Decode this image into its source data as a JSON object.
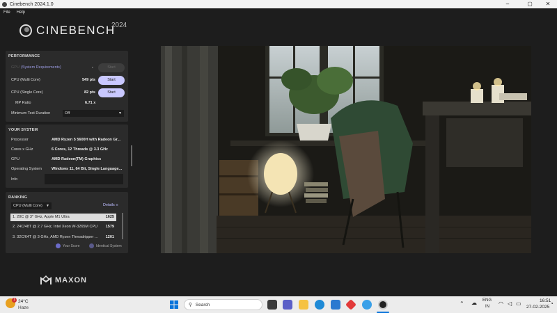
{
  "window": {
    "title": "Cinebench 2024.1.0",
    "controls": {
      "minimize": "–",
      "maximize": "▢",
      "close": "✕"
    }
  },
  "menu": [
    "File",
    "Help"
  ],
  "brand": {
    "name": "CINEBENCH",
    "year": "2024"
  },
  "performance": {
    "heading": "PERFORMANCE",
    "gpu": {
      "label": "GPU",
      "link": "(System Requirements)",
      "value": "-",
      "button": "Start"
    },
    "cpu_multi": {
      "label": "CPU (Multi Core)",
      "value": "549 pts",
      "button": "Start"
    },
    "cpu_single": {
      "label": "CPU (Single Core)",
      "value": "82 pts",
      "button": "Start"
    },
    "mp_ratio": {
      "label": "MP Ratio",
      "value": "6.71 x"
    },
    "min_test": {
      "label": "Minimum Test Duration",
      "value": "Off"
    }
  },
  "system": {
    "heading": "YOUR SYSTEM",
    "rows": [
      {
        "label": "Processor",
        "value": "AMD Ryzen 5 5600H with Radeon Gr..."
      },
      {
        "label": "Cores x GHz",
        "value": "6 Cores, 12 Threads @ 3.3 GHz"
      },
      {
        "label": "GPU",
        "value": "AMD Radeon(TM) Graphics"
      },
      {
        "label": "Operating System",
        "value": "Windows 11, 64 Bit, Single Language..."
      },
      {
        "label": "Info",
        "value": ""
      }
    ]
  },
  "ranking": {
    "heading": "RANKING",
    "filter": "CPU (Multi Core)",
    "details": "Details",
    "rows": [
      {
        "name": "1. 20C @ 3* GHz, Apple M1 Ultra",
        "score": "1625"
      },
      {
        "name": "2. 24C/48T @ 2.7 GHz, Intel Xeon W-3265M CPU",
        "score": "1579"
      },
      {
        "name": "3. 32C/64T @ 3 GHz, AMD Ryzen Threadripper ...",
        "score": "1201"
      }
    ],
    "legend": {
      "your_score": "Your Score",
      "identical": "Identical System"
    },
    "colors": {
      "your_score": "#6b6bc9",
      "identical": "#5a5a8a"
    }
  },
  "footer_brand": "MAXON",
  "taskbar": {
    "weather": {
      "temp": "24°C",
      "condition": "Haze",
      "badge": "1"
    },
    "search_placeholder": "Search",
    "tray": {
      "lang1": "ENG",
      "lang2": "IN",
      "time": "16:51",
      "date": "27-02-2025"
    }
  }
}
